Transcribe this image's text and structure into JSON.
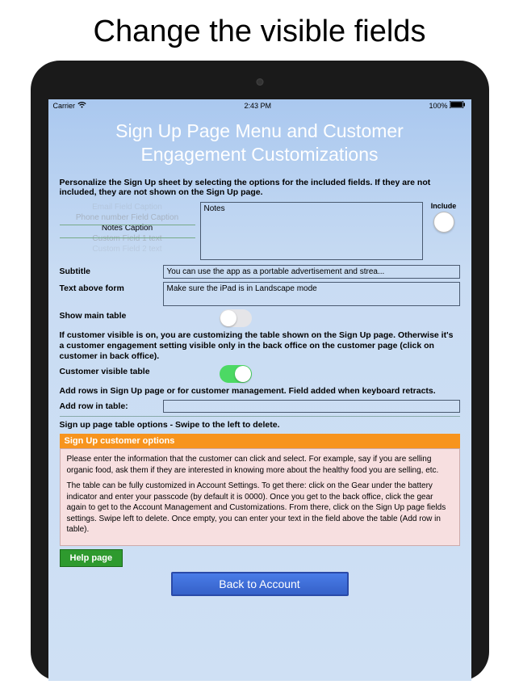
{
  "marketing_title": "Change the visible fields",
  "status": {
    "carrier": "Carrier",
    "time": "2:43 PM",
    "battery": "100%"
  },
  "page_title": "Sign Up Page Menu and Customer Engagement Customizations",
  "intro": "Personalize the Sign Up sheet by selecting the options for the included fields. If they are not included, they are not shown on the Sign Up page.",
  "picker": {
    "opts": [
      "Email Field Caption",
      "Phone number Field Caption",
      "Notes Caption",
      "Custom Field 1 text",
      "Custom Field 2 text"
    ]
  },
  "notes_placeholder": "Notes",
  "include_label": "Include",
  "subtitle_label": "Subtitle",
  "subtitle_value": "You can use the app as a portable advertisement and strea...",
  "text_above_label": "Text above form",
  "text_above_value": "Make sure the iPad is in Landscape mode",
  "show_main_label": "Show main table",
  "cust_visible_desc": "If customer visible is on, you are customizing the table shown on the Sign Up page. Otherwise it's a customer engagement setting visible only in the back office on the customer page (click on customer in back office).",
  "cust_visible_label": "Customer visible table",
  "add_rows_desc": "Add rows in Sign Up page or for customer management. Field added when keyboard retracts.",
  "add_row_label": "Add row in table:",
  "swipe_hint": "Sign up page table options -  Swipe to the left to delete.",
  "options_header": "Sign Up customer options",
  "options_p1": "Please enter the information that the customer can click and select. For example, say if you are selling organic food, ask them if they are interested in knowing more about the healthy food you are selling, etc.",
  "options_p2": "The table can be fully customized in Account Settings. To get there: click on the Gear under the battery indicator and enter your passcode (by default it is 0000). Once you get to the back office, click the gear again to get to the Account Management and Customizations. From there, click on the Sign Up page fields settings. Swipe left to delete. Once empty, you can enter your text in the field above the table (Add row in table).",
  "help_label": "Help page",
  "back_label": "Back to Account"
}
